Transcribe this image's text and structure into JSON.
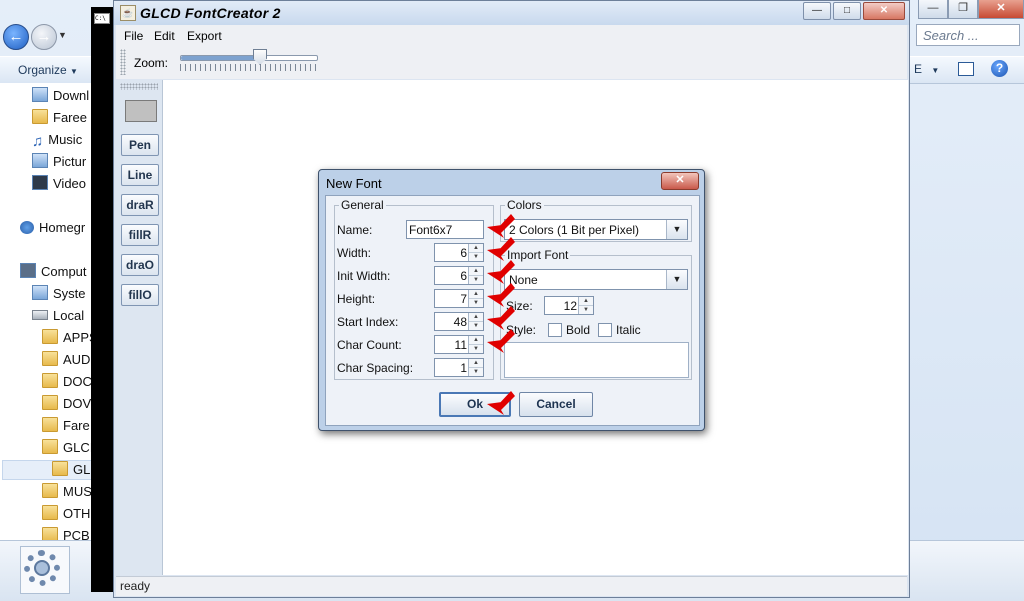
{
  "explorer": {
    "search_placeholder": "Search ...",
    "organize_label": "Organize",
    "tree": [
      {
        "label": "Downl",
        "icon": "downloads-icon"
      },
      {
        "label": "Faree",
        "icon": "folder-icon"
      },
      {
        "label": "Music",
        "icon": "music-icon"
      },
      {
        "label": "Pictur",
        "icon": "pictures-icon"
      },
      {
        "label": "Video",
        "icon": "videos-icon"
      },
      {
        "label": "Homegr",
        "icon": "homegroup-icon"
      },
      {
        "label": "Comput",
        "icon": "computer-icon"
      },
      {
        "label": "Syste",
        "icon": "system-drive-icon"
      },
      {
        "label": "Local",
        "icon": "local-drive-icon"
      },
      {
        "label": "APPS",
        "icon": "folder-icon"
      },
      {
        "label": "AUD",
        "icon": "folder-icon"
      },
      {
        "label": "DOC",
        "icon": "folder-icon"
      },
      {
        "label": "DOV",
        "icon": "folder-icon"
      },
      {
        "label": "Fare",
        "icon": "folder-icon"
      },
      {
        "label": "GLCI",
        "icon": "folder-icon"
      },
      {
        "label": "GL",
        "icon": "folder-icon"
      },
      {
        "label": "MUS",
        "icon": "folder-icon"
      },
      {
        "label": "OTH",
        "icon": "folder-icon"
      },
      {
        "label": "PCB",
        "icon": "folder-icon"
      }
    ]
  },
  "app": {
    "title": "GLCD FontCreator 2",
    "menu": [
      "File",
      "Edit",
      "Export"
    ],
    "zoom_label": "Zoom:",
    "zoom_level": 0.58,
    "tools": [
      "Pen",
      "Line",
      "draR",
      "fillR",
      "draO",
      "fillO"
    ],
    "status": "ready"
  },
  "dialog": {
    "title": "New Font",
    "general_legend": "General",
    "fields": {
      "name": {
        "label": "Name:",
        "value": "Font6x7"
      },
      "width": {
        "label": "Width:",
        "value": "6"
      },
      "init_width": {
        "label": "Init Width:",
        "value": "6"
      },
      "height": {
        "label": "Height:",
        "value": "7"
      },
      "start_index": {
        "label": "Start Index:",
        "value": "48"
      },
      "char_count": {
        "label": "Char Count:",
        "value": "11"
      },
      "char_spacing": {
        "label": "Char Spacing:",
        "value": "1"
      }
    },
    "colors_legend": "Colors",
    "colors_value": "2 Colors (1 Bit per Pixel)",
    "import_legend": "Import Font",
    "import_value": "None",
    "size_label": "Size:",
    "size_value": "12",
    "style_label": "Style:",
    "bold_label": "Bold",
    "italic_label": "Italic",
    "ok_label": "Ok",
    "cancel_label": "Cancel"
  },
  "colors": {
    "annotation_arrow": "#e00000"
  }
}
